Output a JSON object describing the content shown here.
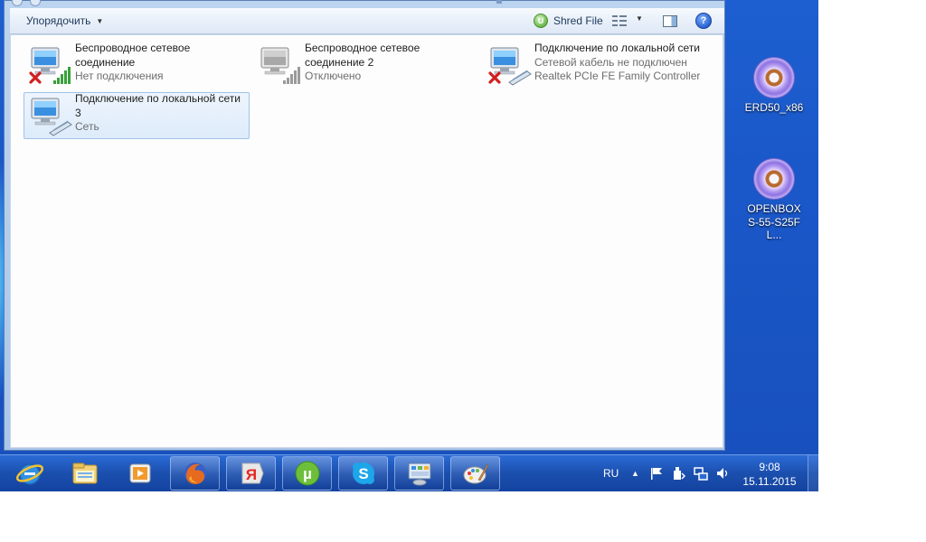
{
  "toolbar": {
    "organize_label": "Упорядочить",
    "shred_label": "Shred File"
  },
  "connections": [
    {
      "name": "Беспроводное сетевое соединение",
      "status": "Нет подключения",
      "detail": "",
      "type": "wireless",
      "state": "disconnected"
    },
    {
      "name": "Беспроводное сетевое соединение 2",
      "status": "Отключено",
      "detail": "",
      "type": "wireless",
      "state": "disabled"
    },
    {
      "name": "Подключение по локальной сети",
      "status": "Сетевой кабель не подключен",
      "detail": "Realtek PCIe FE Family Controller",
      "type": "wired",
      "state": "disconnected"
    },
    {
      "name": "Подключение по локальной сети 3",
      "status": "Сеть",
      "detail": "",
      "type": "wired",
      "state": "connected",
      "selected": true
    }
  ],
  "desktop_icons": [
    {
      "label": "ERD50_x86",
      "icon": "dvd-disc-icon"
    },
    {
      "label": "OPENBOX S-55-S25FL...",
      "icon": "dvd-disc-icon"
    }
  ],
  "taskbar": {
    "apps": [
      "internet-explorer-icon",
      "file-explorer-icon",
      "media-player-icon",
      "firefox-icon",
      "yandex-icon",
      "utorrent-icon",
      "skype-icon",
      "control-panel-icon",
      "paint-icon"
    ],
    "language": "RU",
    "time": "9:08",
    "date": "15.11.2015"
  },
  "colors": {
    "desktop": "#1a57c8",
    "taskbar": "#1b4fae",
    "selection": "#ddebfa"
  }
}
